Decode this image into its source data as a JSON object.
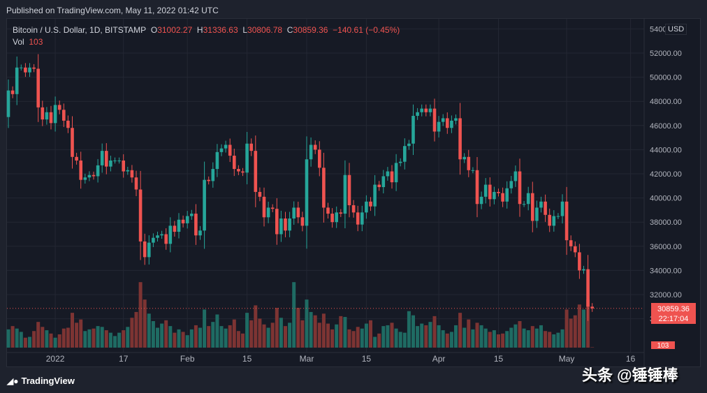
{
  "header": {
    "published": "Published on TradingView.com, May 11, 2022 01:42 UTC"
  },
  "legend": {
    "symbol": "Bitcoin / U.S. Dollar, 1D, BITSTAMP",
    "o_label": "O",
    "o": "31002.27",
    "h_label": "H",
    "h": "31336.63",
    "l_label": "L",
    "l": "30806.78",
    "c_label": "C",
    "c": "30859.36",
    "change": "−140.61 (−0.45%)",
    "vol_label": "Vol",
    "vol": "103"
  },
  "currency": "USD",
  "price_badge": {
    "price": "30859.36",
    "countdown": "22:17:04"
  },
  "vol_badge": "103",
  "footer": {
    "logo_text": "TradingView"
  },
  "watermark": "头条 @锤锤棒",
  "colors": {
    "up": "#26a69a",
    "down": "#ef5350",
    "background": "#161a25"
  },
  "chart_data": {
    "type": "candlestick",
    "start_date": "2021-12-21",
    "ylim": [
      29000,
      54500
    ],
    "y_ticks": [
      30000,
      32000,
      34000,
      36000,
      38000,
      40000,
      42000,
      44000,
      46000,
      48000,
      50000,
      52000,
      54000
    ],
    "x_ticks": [
      {
        "label": "2022",
        "date": "2022-01-01"
      },
      {
        "label": "17",
        "date": "2022-01-17"
      },
      {
        "label": "Feb",
        "date": "2022-02-01"
      },
      {
        "label": "15",
        "date": "2022-02-15"
      },
      {
        "label": "Mar",
        "date": "2022-03-01"
      },
      {
        "label": "15",
        "date": "2022-03-15"
      },
      {
        "label": "Apr",
        "date": "2022-04-01"
      },
      {
        "label": "15",
        "date": "2022-04-15"
      },
      {
        "label": "May",
        "date": "2022-05-01"
      },
      {
        "label": "16",
        "date": "2022-05-16"
      }
    ],
    "first_open": 46700,
    "close": [
      48900,
      48600,
      50800,
      50800,
      50400,
      50800,
      50700,
      47500,
      46500,
      47100,
      46200,
      47700,
      47300,
      46400,
      45800,
      43400,
      43100,
      41500,
      41700,
      41900,
      41800,
      42700,
      43900,
      42600,
      43100,
      43100,
      43100,
      42200,
      42300,
      41700,
      40700,
      36400,
      35100,
      36300,
      36700,
      36900,
      37000,
      36200,
      37700,
      37200,
      38200,
      37900,
      38500,
      38700,
      36900,
      37300,
      41500,
      41400,
      42400,
      43800,
      44100,
      44400,
      43500,
      42400,
      42200,
      42100,
      44500,
      43900,
      40500,
      40100,
      38400,
      39200,
      39100,
      37000,
      38300,
      37300,
      38300,
      39200,
      38400,
      37700,
      43200,
      44400,
      44000,
      42500,
      39200,
      38700,
      38000,
      38800,
      38700,
      41900,
      39400,
      38800,
      37800,
      38800,
      39700,
      39300,
      41100,
      40900,
      41800,
      42200,
      41300,
      42900,
      43000,
      44300,
      44500,
      46800,
      47100,
      47400,
      47100,
      47400,
      45500,
      46300,
      46600,
      45800,
      46400,
      46600,
      43200,
      43400,
      42300,
      42300,
      39500,
      40100,
      41100,
      39900,
      40500,
      40400,
      39700,
      40800,
      41400,
      42200,
      39500,
      39500,
      40400,
      38100,
      39200,
      39700,
      38600,
      37700,
      38500,
      38500,
      39700,
      36500,
      36000,
      35500,
      34000,
      34100,
      31000,
      30859.36
    ],
    "volume": [
      2200,
      2600,
      2300,
      1900,
      1200,
      1300,
      2000,
      3100,
      2500,
      2100,
      1700,
      1200,
      1600,
      2300,
      2400,
      4200,
      3000,
      3400,
      2000,
      2200,
      2300,
      2600,
      2500,
      2100,
      1800,
      1400,
      1800,
      2100,
      2500,
      3600,
      4300,
      7900,
      5800,
      4100,
      3200,
      2400,
      2900,
      3300,
      2600,
      1800,
      2200,
      1900,
      1500,
      2200,
      2700,
      2400,
      4600,
      2600,
      3100,
      4000,
      2600,
      2300,
      2700,
      3400,
      2000,
      1700,
      4200,
      3300,
      5100,
      3500,
      2800,
      2400,
      3000,
      4800,
      3600,
      2600,
      3000,
      7900,
      4800,
      3300,
      5800,
      4300,
      3900,
      3000,
      4100,
      2900,
      2200,
      2800,
      3800,
      3700,
      2200,
      2000,
      2500,
      2300,
      2900,
      3300,
      1300,
      1700,
      2600,
      2700,
      3000,
      2300,
      1900,
      1800,
      4400,
      3900,
      2600,
      2900,
      2700,
      3100,
      3800,
      2700,
      2100,
      1700,
      1900,
      2700,
      4200,
      2400,
      3400,
      2200,
      3000,
      2700,
      2300,
      1900,
      2100,
      1600,
      1700,
      2000,
      2400,
      2800,
      3200,
      2300,
      2100,
      2600,
      2300,
      2700,
      2000,
      1900,
      1600,
      1800,
      2200,
      4600,
      3500,
      3900,
      5200,
      4600,
      5800,
      50
    ],
    "last_price_line": 30859.36
  }
}
